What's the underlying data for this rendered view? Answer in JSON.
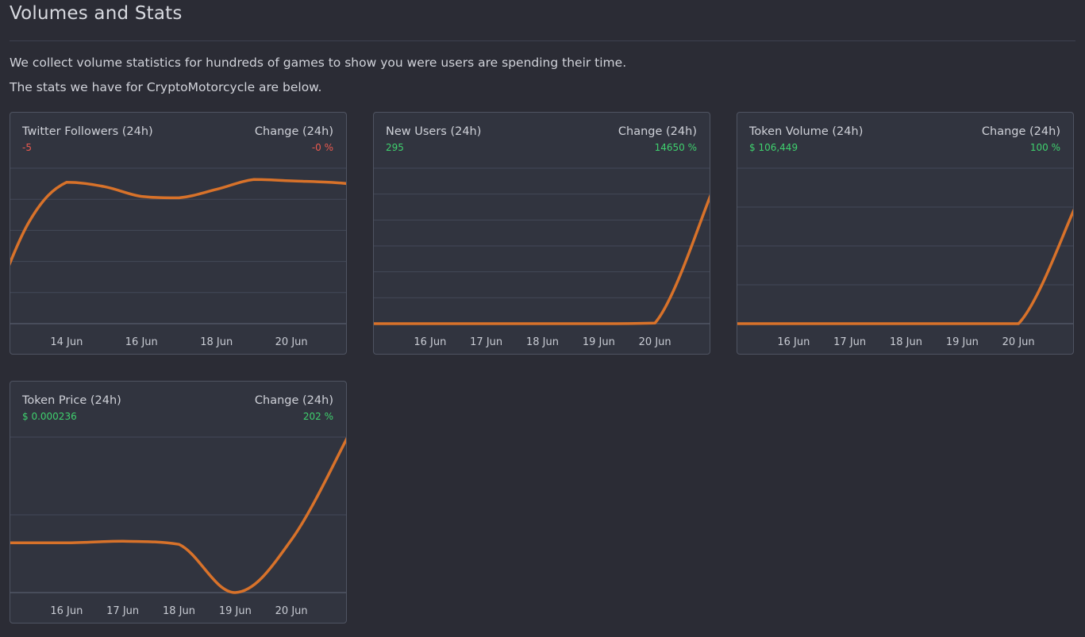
{
  "page": {
    "title": "Volumes and Stats",
    "intro_line1": "We collect volume statistics for hundreds of games to show you were users are spending their time.",
    "intro_line2": "The stats we have for CryptoMotorcycle are below."
  },
  "colors": {
    "background": "#2b2c35",
    "card": "#31343f",
    "line": "#d8722a",
    "positive": "#3fd16e",
    "negative": "#ec5a4f"
  },
  "cards": [
    {
      "label": "Twitter Followers (24h)",
      "value": "-5",
      "value_status": "negative",
      "change_label": "Change (24h)",
      "change_value": "-0 %",
      "change_status": "negative"
    },
    {
      "label": "New Users (24h)",
      "value": "295",
      "value_status": "positive",
      "change_label": "Change (24h)",
      "change_value": "14650 %",
      "change_status": "positive"
    },
    {
      "label": "Token Volume (24h)",
      "value": "$ 106,449",
      "value_status": "positive",
      "change_label": "Change (24h)",
      "change_value": "100 %",
      "change_status": "positive"
    },
    {
      "label": "Token Price (24h)",
      "value": "$ 0.000236",
      "value_status": "positive",
      "change_label": "Change (24h)",
      "change_value": "202 %",
      "change_status": "positive"
    }
  ],
  "chart_data": [
    {
      "type": "line",
      "ticks": [
        "14 Jun",
        "16 Jun",
        "18 Jun",
        "20 Jun"
      ],
      "tick_x": [
        2,
        4,
        6,
        8
      ],
      "x": [
        0,
        1,
        2,
        3,
        4,
        5,
        6,
        7,
        8,
        9,
        10
      ],
      "values": [
        0.1,
        0.72,
        1.0,
        0.97,
        0.9,
        0.89,
        0.95,
        1.02,
        1.01,
        1.0,
        0.98
      ],
      "xlim": [
        0.5,
        9.5
      ],
      "ylim": [
        0,
        1.1
      ],
      "grid": true,
      "gridlines": 5
    },
    {
      "type": "line",
      "ticks": [
        "16 Jun",
        "17 Jun",
        "18 Jun",
        "19 Jun",
        "20 Jun"
      ],
      "tick_x": [
        1,
        2,
        3,
        4,
        5
      ],
      "x": [
        0,
        1,
        2,
        3,
        4,
        5,
        6
      ],
      "values": [
        0,
        0,
        0,
        0,
        0,
        0.005,
        1.0
      ],
      "xlim": [
        0,
        6
      ],
      "ylim": [
        0,
        1.2
      ],
      "grid": true,
      "gridlines": 6
    },
    {
      "type": "line",
      "ticks": [
        "16 Jun",
        "17 Jun",
        "18 Jun",
        "19 Jun",
        "20 Jun"
      ],
      "tick_x": [
        1,
        2,
        3,
        4,
        5
      ],
      "x": [
        0,
        1,
        2,
        3,
        4,
        5,
        6
      ],
      "values": [
        0,
        0,
        0,
        0,
        0,
        0,
        1.0
      ],
      "xlim": [
        0,
        6
      ],
      "ylim": [
        0,
        1.35
      ],
      "grid": true,
      "gridlines": 4
    },
    {
      "type": "line",
      "ticks": [
        "16 Jun",
        "17 Jun",
        "18 Jun",
        "19 Jun",
        "20 Jun"
      ],
      "tick_x": [
        1,
        2,
        3,
        4,
        5
      ],
      "x": [
        0,
        1,
        2,
        3,
        4,
        5,
        6
      ],
      "values": [
        0.32,
        0.32,
        0.33,
        0.31,
        0.0,
        0.34,
        1.0
      ],
      "xlim": [
        0,
        6
      ],
      "ylim": [
        0,
        1.0
      ],
      "grid": true,
      "gridlines": 2
    }
  ]
}
